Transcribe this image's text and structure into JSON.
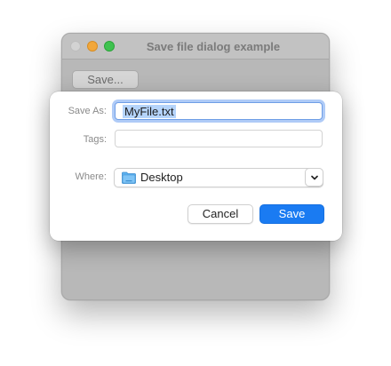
{
  "parent_window": {
    "title": "Save file dialog example",
    "save_button_label": "Save..."
  },
  "sheet": {
    "save_as": {
      "label": "Save As:",
      "value": "MyFile.txt"
    },
    "tags": {
      "label": "Tags:",
      "value": ""
    },
    "where": {
      "label": "Where:",
      "value": "Desktop",
      "icon": "folder-icon"
    },
    "buttons": {
      "cancel_label": "Cancel",
      "save_label": "Save"
    }
  },
  "colors": {
    "accent": "#1a7bf2",
    "selection": "#b5d4fb",
    "focus_ring": "#6f9ee6",
    "traffic_minimize": "#f2a73a",
    "traffic_zoom": "#3ec24f"
  }
}
